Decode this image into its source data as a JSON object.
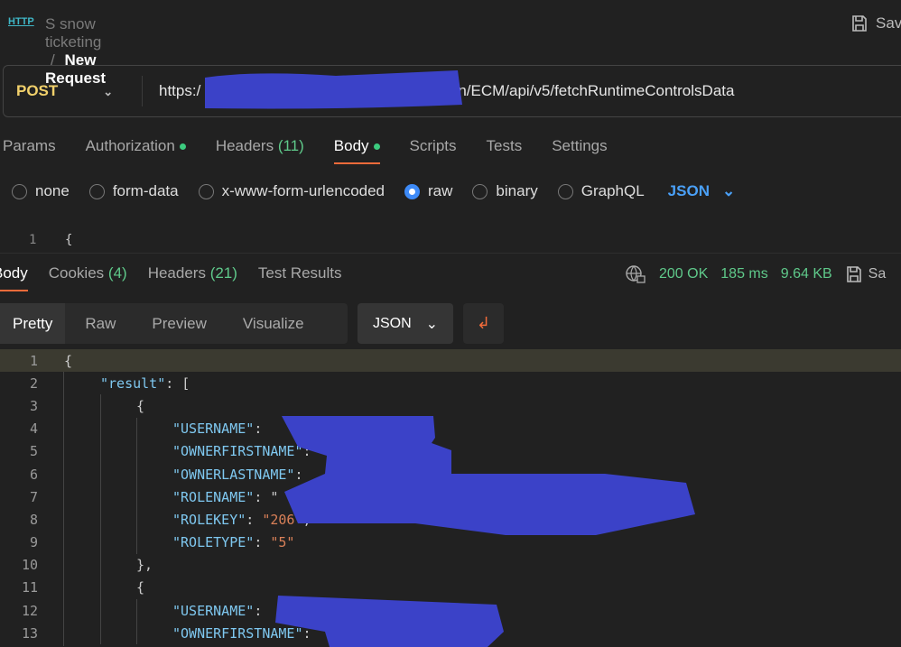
{
  "header": {
    "collection": "S snow ticketing",
    "separator": "/",
    "request": "New Request",
    "save": "Sav",
    "http_icon": "HTTP"
  },
  "request": {
    "method": "POST",
    "url_prefix": "https:/",
    "url_suffix": "n/ECM/api/v5/fetchRuntimeControlsData"
  },
  "tabs": [
    {
      "label": "Params"
    },
    {
      "label": "Authorization",
      "dot": true
    },
    {
      "label": "Headers",
      "count": "(11)"
    },
    {
      "label": "Body",
      "dot": true,
      "active": true
    },
    {
      "label": "Scripts"
    },
    {
      "label": "Tests"
    },
    {
      "label": "Settings"
    }
  ],
  "body_types": [
    {
      "label": "none"
    },
    {
      "label": "form-data"
    },
    {
      "label": "x-www-form-urlencoded"
    },
    {
      "label": "raw",
      "selected": true
    },
    {
      "label": "binary"
    },
    {
      "label": "GraphQL"
    }
  ],
  "body_format": "JSON",
  "editor_line1": {
    "num": "1",
    "text": "{"
  },
  "response": {
    "tabs": [
      {
        "label": "Body",
        "active": true
      },
      {
        "label": "Cookies",
        "count": "(4)"
      },
      {
        "label": "Headers",
        "count": "(21)"
      },
      {
        "label": "Test Results"
      }
    ],
    "status": "200 OK",
    "time": "185 ms",
    "size": "9.64 KB",
    "save": "Sa",
    "views": [
      "Pretty",
      "Raw",
      "Preview",
      "Visualize"
    ],
    "active_view": "Pretty",
    "format": "JSON",
    "lines": [
      {
        "n": "1",
        "indent": 0,
        "text": "{"
      },
      {
        "n": "2",
        "indent": 1,
        "key": "\"result\"",
        "rest": ": ["
      },
      {
        "n": "3",
        "indent": 2,
        "text": "{"
      },
      {
        "n": "4",
        "indent": 3,
        "key": "\"USERNAME\"",
        "rest": ":"
      },
      {
        "n": "5",
        "indent": 3,
        "key": "\"OWNERFIRSTNAME\"",
        "rest": ":"
      },
      {
        "n": "6",
        "indent": 3,
        "key": "\"OWNERLASTNAME\"",
        "rest": ":"
      },
      {
        "n": "7",
        "indent": 3,
        "key": "\"ROLENAME\"",
        "rest": ": \""
      },
      {
        "n": "8",
        "indent": 3,
        "key": "\"ROLEKEY\"",
        "rest": ": ",
        "val": "\"206\"",
        "tail": ","
      },
      {
        "n": "9",
        "indent": 3,
        "key": "\"ROLETYPE\"",
        "rest": ": ",
        "val": "\"5\""
      },
      {
        "n": "10",
        "indent": 2,
        "text": "},"
      },
      {
        "n": "11",
        "indent": 2,
        "text": "{"
      },
      {
        "n": "12",
        "indent": 3,
        "key": "\"USERNAME\"",
        "rest": ":"
      },
      {
        "n": "13",
        "indent": 3,
        "key": "\"OWNERFIRSTNAME\"",
        "rest": ":"
      }
    ]
  },
  "colors": {
    "accent": "#f26b3a",
    "status": "#5fc98a",
    "method": "#f2d16b",
    "redaction": "#3b42c8"
  }
}
